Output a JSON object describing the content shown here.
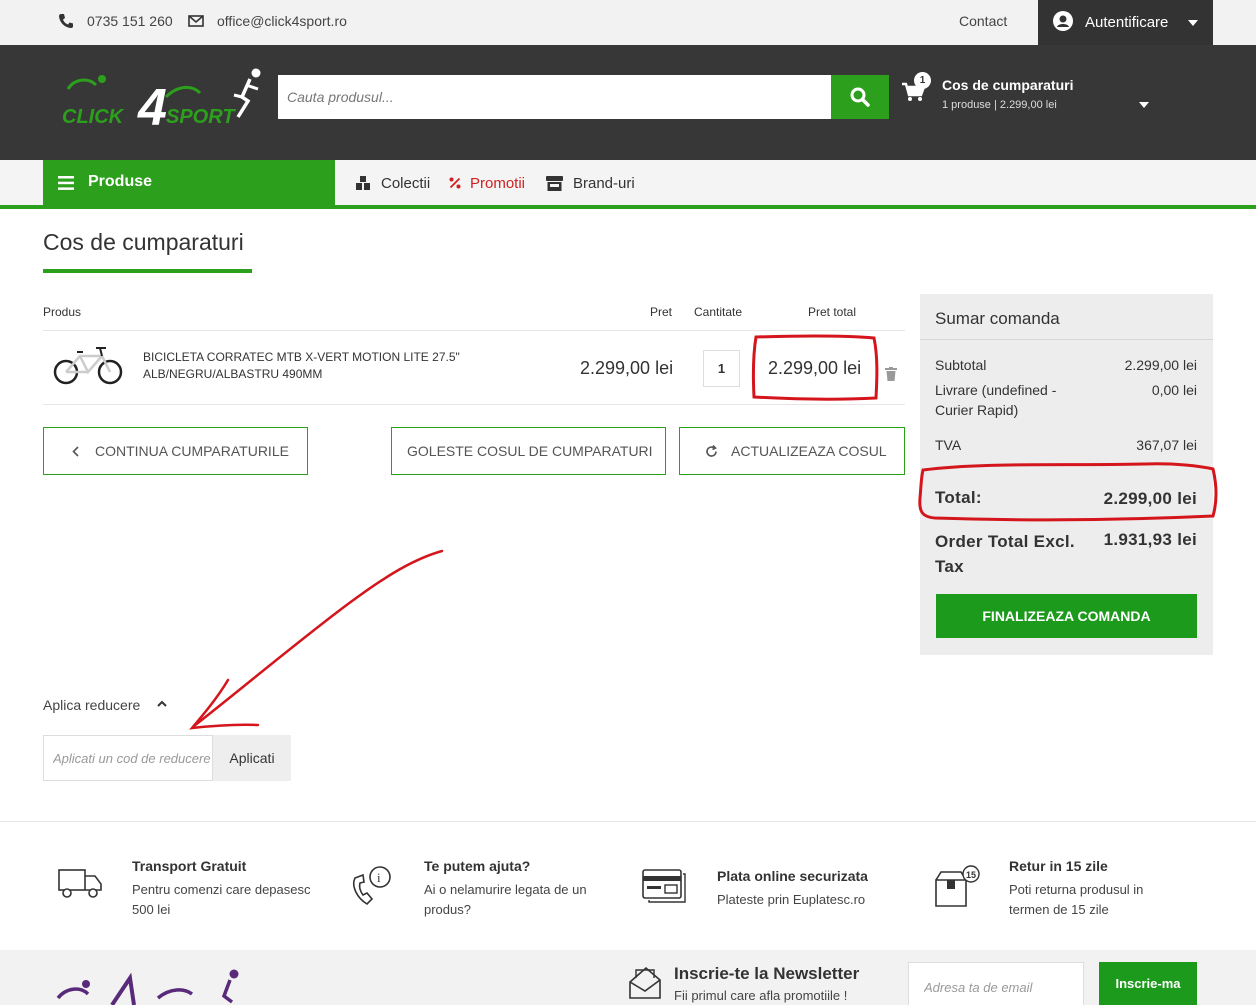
{
  "topbar": {
    "phone": "0735 151 260",
    "email": "office@click4sport.ro",
    "contact": "Contact",
    "auth": "Autentificare"
  },
  "header": {
    "search_placeholder": "Cauta produsul...",
    "cart_count": "1",
    "cart_title": "Cos de cumparaturi",
    "cart_summary": "1 produse | 2.299,00 lei"
  },
  "nav": {
    "produse": "Produse",
    "colectii": "Colectii",
    "promotii": "Promotii",
    "branduri": "Brand-uri"
  },
  "page": {
    "title": "Cos de cumparaturi"
  },
  "table": {
    "headers": {
      "product": "Produs",
      "price": "Pret",
      "qty": "Cantitate",
      "total": "Pret total"
    },
    "items": [
      {
        "name": "BICICLETA CORRATEC MTB X-VERT MOTION LITE 27.5\" ALB/NEGRU/ALBASTRU 490MM",
        "price": "2.299,00 lei",
        "qty": "1",
        "total": "2.299,00 lei"
      }
    ]
  },
  "actions": {
    "continue": "CONTINUA CUMPARATURILE",
    "empty": "GOLESTE COSUL DE CUMPARATURI",
    "update": "ACTUALIZEAZA COSUL"
  },
  "summary": {
    "title": "Sumar comanda",
    "subtotal_label": "Subtotal",
    "subtotal": "2.299,00 lei",
    "shipping_label": "Livrare (undefined - Curier Rapid)",
    "shipping": "0,00 lei",
    "tax_label": "TVA",
    "tax": "367,07 lei",
    "total_label": "Total:",
    "total": "2.299,00 lei",
    "excl_label": "Order Total Excl. Tax",
    "excl": "1.931,93 lei",
    "finalize": "FINALIZEAZA COMANDA"
  },
  "discount": {
    "label": "Aplica reducere",
    "placeholder": "Aplicati un cod de reducere",
    "apply": "Aplicati"
  },
  "features": [
    {
      "title": "Transport Gratuit",
      "desc": "Pentru comenzi care depasesc 500 lei"
    },
    {
      "title": "Te putem ajuta?",
      "desc": "Ai o nelamurire legata de un produs?"
    },
    {
      "title": "Plata online securizata",
      "desc": "Plateste prin Euplatesc.ro"
    },
    {
      "title": "Retur in 15 zile",
      "desc": "Poti returna produsul in termen de 15 zile"
    }
  ],
  "newsletter": {
    "title": "Inscrie-te la Newsletter",
    "subtitle": "Fii primul care afla promotiile !",
    "placeholder": "Adresa ta de email",
    "button": "Inscrie-ma",
    "return_badge": "15"
  },
  "colors": {
    "brand_green": "#2ca01c",
    "dark": "#373737",
    "annotation_red": "#d4161c",
    "promo_red": "#d02020"
  }
}
